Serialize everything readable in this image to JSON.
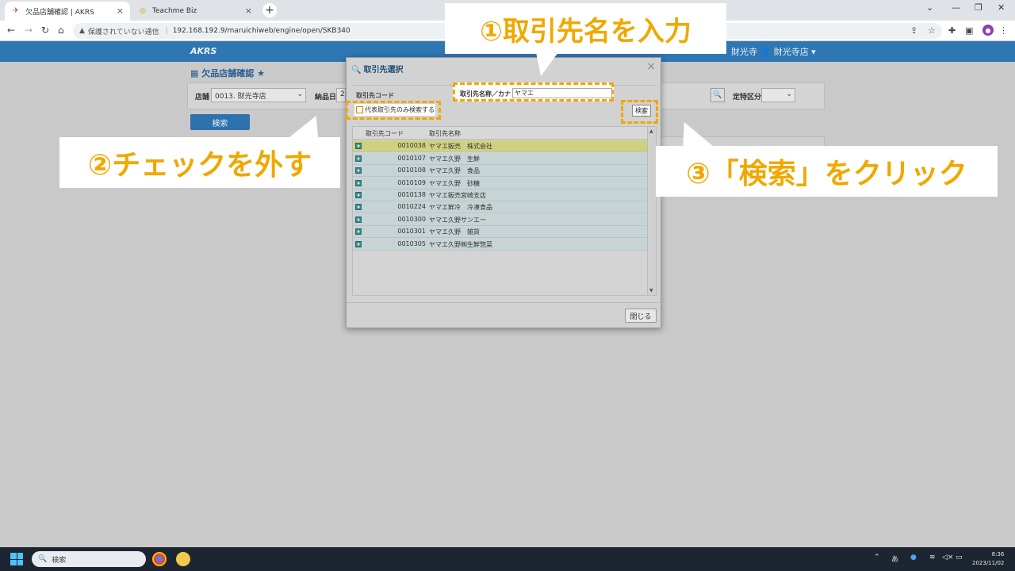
{
  "browser": {
    "tabs": [
      {
        "title": "欠品店舗確認 | AKRS",
        "active": true
      },
      {
        "title": "Teachme Biz",
        "active": false
      }
    ],
    "insecure_label": "保護されていない通信",
    "url": "192.168.192.9/maruichiweb/engine/open/SKB340"
  },
  "app": {
    "brand": "AKRS",
    "user": "財光寺  👤 財光寺店 ▾",
    "page_title": "欠品店舗確認 ★",
    "filters": {
      "store_label": "店舗",
      "store_value": "0013. 財光寺店",
      "delivery_label": "納品日",
      "delivery_value": "2",
      "special_label": "定特区分"
    },
    "search_button": "検索"
  },
  "dialog": {
    "title": "取引先選択",
    "code_label": "取引先コード",
    "name_label": "取引先名称／カナ",
    "name_value": "ヤマエ",
    "checkbox_label": "代表取引先のみ検索する",
    "search_button": "検索",
    "columns": [
      "取引先コード",
      "取引先名称"
    ],
    "rows": [
      {
        "code": "0010038",
        "name": "ヤマエ販売　株式会社"
      },
      {
        "code": "0010107",
        "name": "ヤマエ久野　生鮮"
      },
      {
        "code": "0010108",
        "name": "ヤマエ久野　食品"
      },
      {
        "code": "0010109",
        "name": "ヤマエ久野　砂糖"
      },
      {
        "code": "0010138",
        "name": "ヤマエ販売宮崎支店"
      },
      {
        "code": "0010224",
        "name": "ヤマエ鮮冷　冷凍食品"
      },
      {
        "code": "0010300",
        "name": "ヤマエ久野サンエー"
      },
      {
        "code": "0010301",
        "name": "ヤマエ久野　雑貨"
      },
      {
        "code": "0010305",
        "name": "ヤマエ久野㈱生鮮惣菜"
      }
    ],
    "close_button": "閉じる"
  },
  "callouts": {
    "step1": "①取引先名を入力",
    "step2": "②チェックを外す",
    "step3": "③「検索」をクリック"
  },
  "taskbar": {
    "search_placeholder": "検索",
    "ime": "あ",
    "time": "8:36",
    "date": "2023/11/02"
  },
  "colors": {
    "accent": "#f0a800",
    "app_header": "#2f77b3"
  }
}
